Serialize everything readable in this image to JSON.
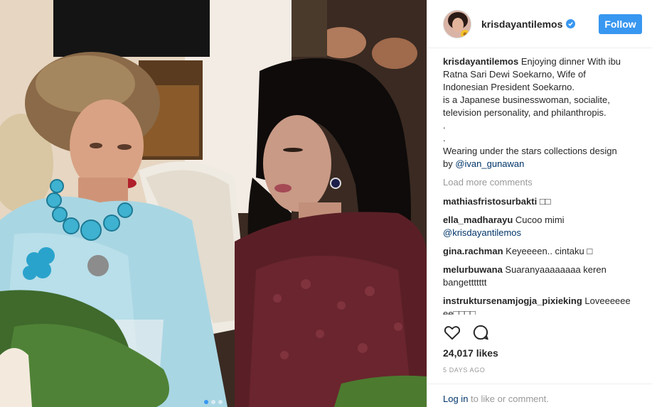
{
  "header": {
    "username": "krisdayantilemos",
    "follow_label": "Follow"
  },
  "caption": {
    "username": "krisdayantilemos",
    "line1": "Enjoying dinner With ibu",
    "line2": "Ratna Sari Dewi Soekarno, Wife of",
    "line3": "Indonesian President Soekarno.",
    "line4": "is a Japanese businesswoman, socialite,",
    "line5": "television personality, and philanthropis.",
    "line6": ".",
    "line7": ".",
    "line8": "Wearing under the stars collections design",
    "line9_prefix": "by ",
    "mention": "@ivan_gunawan"
  },
  "load_more": "Load more comments",
  "comments": [
    {
      "user": "mathiasfristosurbakti",
      "text": "□□"
    },
    {
      "user": "ella_madharayu",
      "text": "Cucoo mimi",
      "mention": "@krisdayantilemos"
    },
    {
      "user": "gina.rachman",
      "text": "Keyeeeen.. cintaku □"
    },
    {
      "user": "melurbuwana",
      "text": "Suaranyaaaaaaaa keren bangettttttt"
    },
    {
      "user": "instruktursenamjogja_pixieking",
      "text": "Loveeeeee ee□□□□"
    }
  ],
  "actions": {
    "like_icon": "heart-icon",
    "comment_icon": "comment-icon"
  },
  "likes": "24,017 likes",
  "date": "5 DAYS AGO",
  "footer": {
    "login": "Log in",
    "rest": " to like or comment."
  },
  "carousel": {
    "active_index": 0,
    "count": 3
  },
  "colors": {
    "accent": "#3897f0",
    "link": "#003569",
    "muted": "#999999",
    "text": "#262626"
  }
}
